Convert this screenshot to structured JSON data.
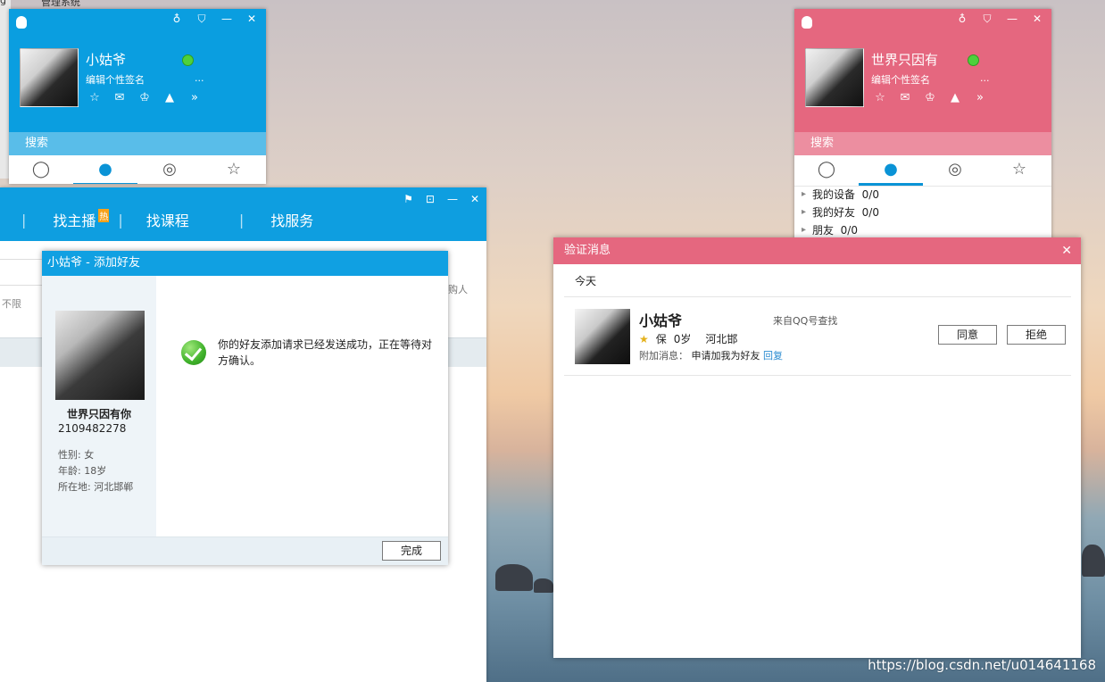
{
  "desktop": {
    "labels": [
      "g",
      "管理系统"
    ],
    "watermark": "https://blog.csdn.net/u014641168"
  },
  "qq_left": {
    "nickname": "小姑爷",
    "signature": "编辑个性签名",
    "more": "...",
    "search_label": "搜索",
    "colors": {
      "accent": "#0a9ee0",
      "search_bar": "#59bde9"
    }
  },
  "qq_right": {
    "nickname": "世界只因有",
    "signature": "编辑个性签名",
    "more": "...",
    "search_label": "搜索",
    "groups": [
      {
        "name": "我的设备",
        "count": "0/0"
      },
      {
        "name": "我的好友",
        "count": "0/0"
      },
      {
        "name": "朋友",
        "count": "0/0"
      }
    ],
    "colors": {
      "accent": "#e5677f",
      "search_bar": "#ec8ea0"
    }
  },
  "class_window": {
    "nav": [
      {
        "label": "找主播",
        "badge": "热"
      },
      {
        "label": "找课程"
      },
      {
        "label": "找服务"
      }
    ],
    "side_text": "不限",
    "right_text": "购人"
  },
  "add_friend_dialog": {
    "title": "小姑爷 - 添加好友",
    "target_name": "世界只因有你",
    "target_qq": "2109482278",
    "info": [
      "性别: 女",
      "年龄: 18岁",
      "所在地: 河北邯郸"
    ],
    "message": "你的好友添加请求已经发送成功，正在等待对方确认。",
    "done_button": "完成"
  },
  "verify_window": {
    "title": "验证消息",
    "close": "✕",
    "day": "今天",
    "request": {
      "nickname": "小姑爷",
      "source": "来自QQ号查找",
      "badge": "保",
      "age": "0岁",
      "location": "河北邯",
      "extra_label": "附加消息：",
      "extra_text": "申请加我为好友",
      "reply_label": "回复",
      "accept_button": "同意",
      "reject_button": "拒绝"
    }
  }
}
